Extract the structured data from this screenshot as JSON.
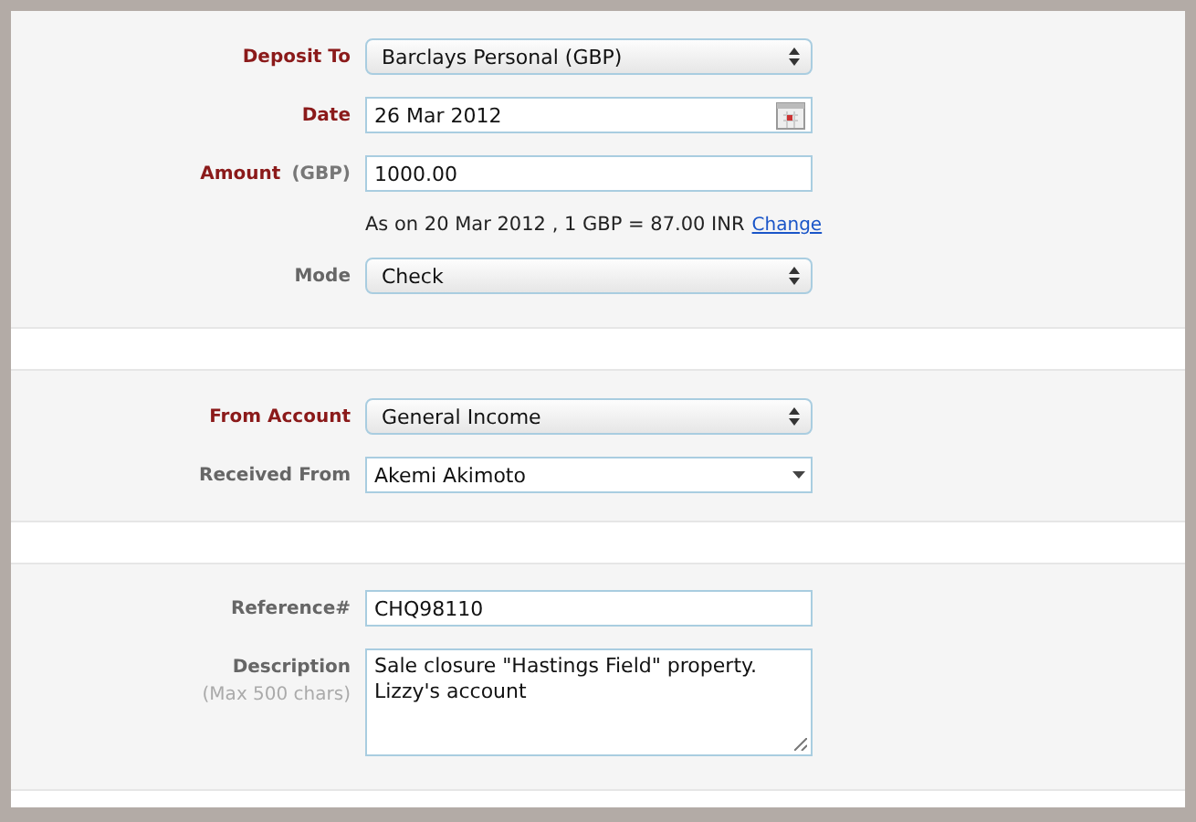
{
  "sections": [
    {
      "fields": [
        {
          "kind": "select",
          "label": "Deposit To",
          "required": true,
          "value": "Barclays Personal (GBP)"
        },
        {
          "kind": "date",
          "label": "Date",
          "required": true,
          "value": "26 Mar 2012"
        },
        {
          "kind": "text",
          "label": "Amount",
          "label_note": "(GBP)",
          "required": true,
          "value": "1000.00"
        },
        {
          "kind": "note",
          "text": "As on 20 Mar 2012 , 1 GBP = 87.00 INR",
          "link": "Change"
        },
        {
          "kind": "select",
          "label": "Mode",
          "required": false,
          "value": "Check"
        }
      ]
    },
    {
      "fields": [
        {
          "kind": "select",
          "label": "From Account",
          "required": true,
          "value": "General Income"
        },
        {
          "kind": "combo",
          "label": "Received From",
          "required": false,
          "value": "Akemi Akimoto"
        }
      ]
    },
    {
      "fields": [
        {
          "kind": "text",
          "label": "Reference#",
          "required": false,
          "value": "CHQ98110"
        },
        {
          "kind": "textarea",
          "label": "Description",
          "hint": "(Max 500 chars)",
          "required": false,
          "value": "Sale closure \"Hastings Field\" property. Lizzy's account"
        }
      ]
    }
  ]
}
